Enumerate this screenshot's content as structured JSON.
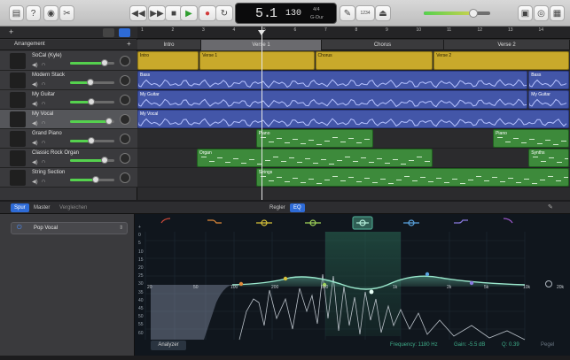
{
  "toolbar": {
    "lcd_bar": "5.",
    "lcd_beat": "1",
    "lcd_tempo": "130",
    "lcd_signature": "4/4",
    "lcd_key": "G-Dur",
    "count_in": "1234"
  },
  "arrangement": {
    "header_label": "Arrangement",
    "ruler_numbers": [
      "1",
      "2",
      "3",
      "4",
      "5",
      "6",
      "7",
      "8",
      "9",
      "10",
      "11",
      "12",
      "13",
      "14"
    ],
    "sections": [
      "Intro",
      "Verse 1",
      "Chorus",
      "Verse 2"
    ]
  },
  "tracks": [
    {
      "name": "SoCal (Kyle)",
      "volume": 0.78
    },
    {
      "name": "Modern Stack",
      "volume": 0.45
    },
    {
      "name": "My Guitar",
      "volume": 0.48
    },
    {
      "name": "My Vocal",
      "volume": 0.88
    },
    {
      "name": "Grand Piano",
      "volume": 0.48
    },
    {
      "name": "Classic Rock Organ",
      "volume": 0.78
    },
    {
      "name": "String Section",
      "volume": 0.58
    }
  ],
  "regions": [
    {
      "lane": 0,
      "color": "yellow",
      "label": "Intro",
      "start": 0,
      "end": 10.5
    },
    {
      "lane": 0,
      "color": "yellow",
      "label": "Verse 1",
      "start": 10.5,
      "end": 30
    },
    {
      "lane": 0,
      "color": "yellow",
      "label": "Chorus",
      "start": 30,
      "end": 50
    },
    {
      "lane": 0,
      "color": "yellow",
      "label": "Verse 2",
      "start": 50,
      "end": 73
    },
    {
      "lane": 1,
      "color": "blue",
      "label": "Bass",
      "start": 0,
      "end": 66
    },
    {
      "lane": 1,
      "color": "blue",
      "label": "Bass",
      "start": 66,
      "end": 73
    },
    {
      "lane": 2,
      "color": "blue",
      "label": "My Guitar",
      "start": 0,
      "end": 66
    },
    {
      "lane": 2,
      "color": "blue",
      "label": "My Guitar",
      "start": 66,
      "end": 73
    },
    {
      "lane": 3,
      "color": "blue",
      "label": "My Vocal",
      "start": 0,
      "end": 73
    },
    {
      "lane": 4,
      "color": "green",
      "label": "Piano",
      "start": 20,
      "end": 40
    },
    {
      "lane": 4,
      "color": "green",
      "label": "Piano",
      "start": 60,
      "end": 73
    },
    {
      "lane": 5,
      "color": "green",
      "label": "Organ",
      "start": 10,
      "end": 50
    },
    {
      "lane": 5,
      "color": "green",
      "label": "Synths",
      "start": 66,
      "end": 73
    },
    {
      "lane": 6,
      "color": "green",
      "label": "Strings",
      "start": 20,
      "end": 73
    }
  ],
  "editor": {
    "tabs_left": [
      "Spur",
      "Master",
      "Vergleichen"
    ],
    "tabs_center": [
      "Regler",
      "EQ"
    ],
    "preset": "Pop Vocal",
    "eq_freq_labels": [
      "20",
      "50",
      "100",
      "200",
      "500",
      "1k",
      "2k",
      "5k",
      "10k",
      "20k"
    ],
    "eq_db_labels": [
      "+",
      "0",
      "5",
      "10",
      "15",
      "20",
      "25",
      "30",
      "35",
      "40",
      "45",
      "50",
      "55",
      "60"
    ],
    "analyzer_label": "Analyzer",
    "frequency_readout": "Frequency: 1180 Hz",
    "gain_readout": "Gain: -5.5 dB",
    "q_readout": "Q: 0.39",
    "right_label": "Pegel"
  }
}
